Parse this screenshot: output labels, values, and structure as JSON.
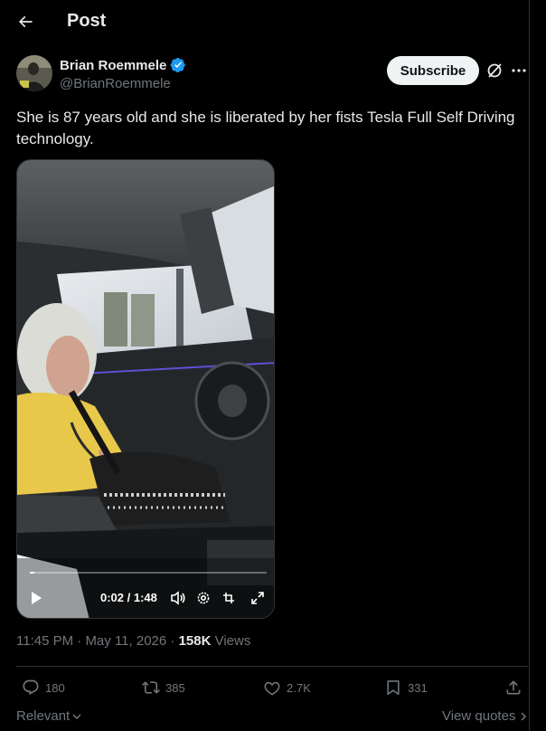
{
  "header": {
    "title": "Post"
  },
  "author": {
    "display_name": "Brian Roemmele",
    "handle": "@BrianRoemmele",
    "verified_color": "#1d9bf0"
  },
  "actions_top": {
    "subscribe_label": "Subscribe"
  },
  "post": {
    "text": "She is 87 years old and she is liberated by her fists Tesla Full Self Driving technology."
  },
  "video": {
    "time_readout": "0:02 / 1:48",
    "progress": 0.02,
    "icons": [
      "play-icon",
      "volume-icon",
      "settings-icon",
      "pip-icon",
      "fullscreen-icon"
    ]
  },
  "meta": {
    "time": "11:45 PM",
    "date": "May 11, 2026",
    "views_count": "158K",
    "views_label": "Views"
  },
  "engagement": {
    "replies": "180",
    "reposts": "385",
    "likes": "2.7K",
    "bookmarks": "331"
  },
  "footer": {
    "sort_label": "Relevant",
    "view_quotes_label": "View quotes"
  }
}
